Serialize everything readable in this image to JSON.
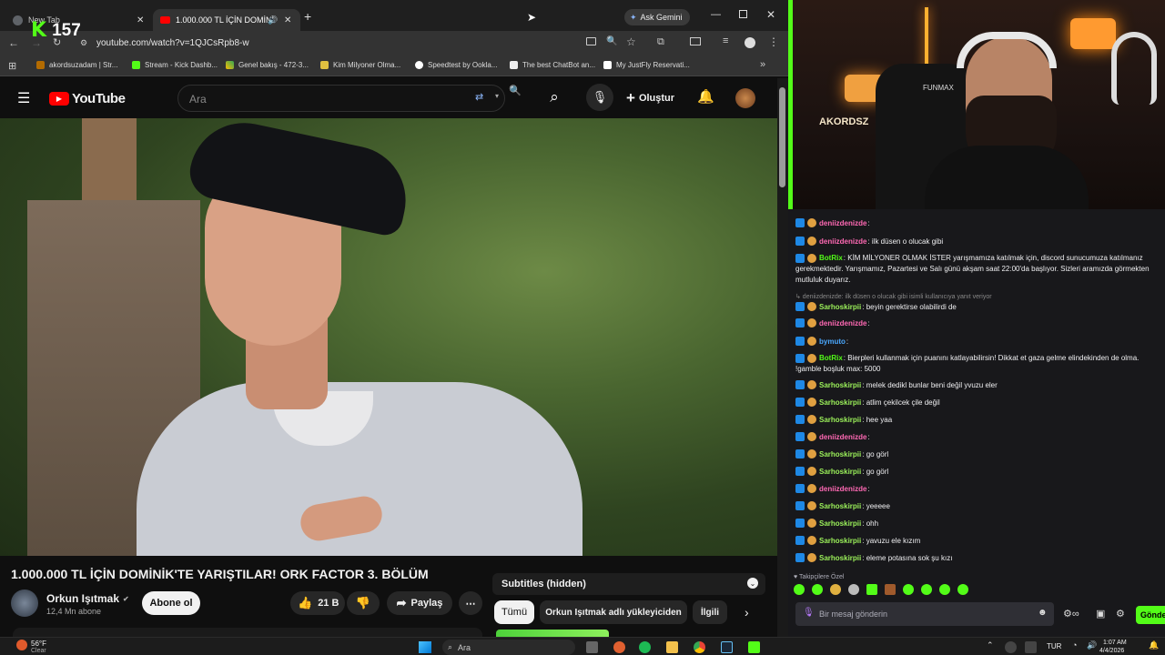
{
  "browser": {
    "tabs": [
      {
        "title": "New Tab"
      },
      {
        "title": "1.000.000 TL İÇİN DOMİNİ"
      }
    ],
    "ask_gemini": "Ask Gemini",
    "url": "youtube.com/watch?v=1QJCsRpb8-w",
    "bookmarks": [
      "akordsuzadam | Str...",
      "Stream - Kick Dashb...",
      "Genel bakış - 472-3...",
      "Kim Milyoner Olma...",
      "Speedtest by Ookla...",
      "The best ChatBot an...",
      "My JustFly Reservati..."
    ]
  },
  "overlay": {
    "viewer_count": "157"
  },
  "youtube": {
    "logo_text": "YouTube",
    "search_placeholder": "Ara",
    "create_label": "Oluştur",
    "video_title": "1.000.000 TL İÇİN DOMİNİK'TE YARIŞTILAR! ORK FACTOR 3. BÖLÜM",
    "channel_name": "Orkun Işıtmak",
    "subscribers": "12,4 Mn abone",
    "subscribe_label": "Abone ol",
    "likes": "21 B",
    "share_label": "Paylaş",
    "subtitles_label": "Subtitles (hidden)",
    "chips": [
      "Tümü",
      "Orkun Işıtmak adlı yükleyiciden",
      "İlgili"
    ]
  },
  "chat": {
    "messages": [
      {
        "user": "deniizdenizde",
        "text": ":",
        "color": "#ff69b4"
      },
      {
        "user": "deniizdenizde",
        "text": ": ilk düsen o olucak gibi",
        "color": "#ff69b4"
      },
      {
        "user": "BotRix",
        "text": ": KİM MİLYONER OLMAK İSTER yarışmamıza katılmak için, discord sunucumuza katılmanız gerekmektedir. Yarışmamız, Pazartesi ve Salı günü akşam saat 22:00'da başlıyor. Sizleri aramızda görmekten mutluluk duyarız.",
        "color": "#53fc18"
      },
      {
        "user": "",
        "text": "↳ deniizdenizde: ilk düsen o olucak gibi isimli kullanıcıya yanıt veriyor",
        "color": "#888888"
      },
      {
        "user": "Sarhoskirpii",
        "text": ": beyin gerektirse olabilirdi de",
        "color": "#9bf05a"
      },
      {
        "user": "deniizdenizde",
        "text": ":",
        "color": "#ff69b4"
      },
      {
        "user": "bymuto",
        "text": ":",
        "color": "#4aa8ff"
      },
      {
        "user": "BotRix",
        "text": ": Bierpleri kullanmak için puanını katlayabilirsin! Dikkat et gaza gelme elindekinden de olma. !gamble boşluk max: 5000",
        "color": "#53fc18"
      },
      {
        "user": "Sarhoskirpii",
        "text": ": melek dedikl bunlar beni değil yvuzu eler",
        "color": "#9bf05a"
      },
      {
        "user": "Sarhoskirpii",
        "text": ": atlim çekilcek çile değil",
        "color": "#9bf05a"
      },
      {
        "user": "Sarhoskirpii",
        "text": ": hee yaa",
        "color": "#9bf05a"
      },
      {
        "user": "deniizdenizde",
        "text": ":",
        "color": "#ff69b4"
      },
      {
        "user": "Sarhoskirpii",
        "text": ": go görl",
        "color": "#9bf05a"
      },
      {
        "user": "Sarhoskirpii",
        "text": ": go görl",
        "color": "#9bf05a"
      },
      {
        "user": "deniizdenizde",
        "text": ":",
        "color": "#ff69b4"
      },
      {
        "user": "Sarhoskirpii",
        "text": ": yeeeee",
        "color": "#9bf05a"
      },
      {
        "user": "Sarhoskirpii",
        "text": ": ohh",
        "color": "#9bf05a"
      },
      {
        "user": "Sarhoskirpii",
        "text": ": yavuzu ele kızım",
        "color": "#9bf05a"
      },
      {
        "user": "Sarhoskirpii",
        "text": ": eleme potasına sok şu kızı",
        "color": "#9bf05a"
      }
    ],
    "followers_only": "Takipçilere Özel",
    "input_placeholder": "Bir mesaj gönderin",
    "send_label": "Gönder"
  },
  "webcam": {
    "sign_text": "AKORDSZ",
    "headphone_brand": "FUNMAX"
  },
  "taskbar": {
    "temperature": "56°F",
    "weather": "Clear",
    "search_label": "Ara",
    "language": "TUR",
    "time": "1:07 AM",
    "date": "4/4/2026"
  }
}
